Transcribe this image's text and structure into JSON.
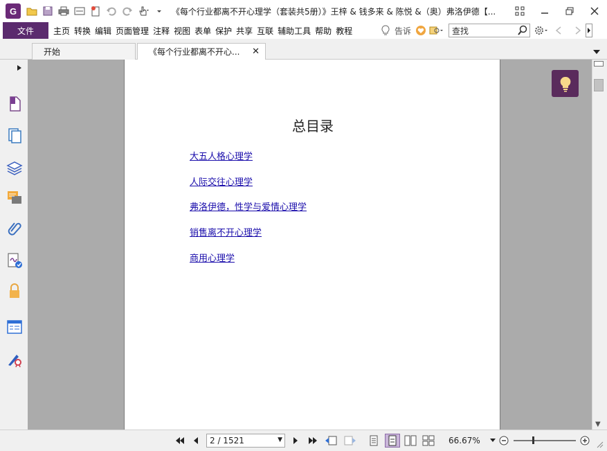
{
  "window": {
    "title": "《每个行业都离不开心理学（套装共5册）》王梓 & 钱多来 & 陈悦 &（奥）弗洛伊德【...",
    "logo_letter": "G",
    "accent_color": "#5b2b6e"
  },
  "menu": {
    "file_label": "文件",
    "items": [
      "主页",
      "转换",
      "编辑",
      "页面管理",
      "注释",
      "视图",
      "表单",
      "保护",
      "共享",
      "互联",
      "辅助工具",
      "帮助",
      "教程"
    ],
    "tell_label": "告诉",
    "search_placeholder": "查找"
  },
  "tabs": {
    "home_label": "开始",
    "doc_label": "《每个行业都离不开心..."
  },
  "document": {
    "toc_title": "总目录",
    "toc_links": [
      "大五人格心理学",
      "人际交往心理学",
      "弗洛伊德，性学与爱情心理学",
      "销售离不开心理学",
      "商用心理学"
    ],
    "link_color": "#1a0dab"
  },
  "status": {
    "page_display": "2 / 1521",
    "zoom": "66.67%",
    "zoom_level_fraction": 0.31
  }
}
